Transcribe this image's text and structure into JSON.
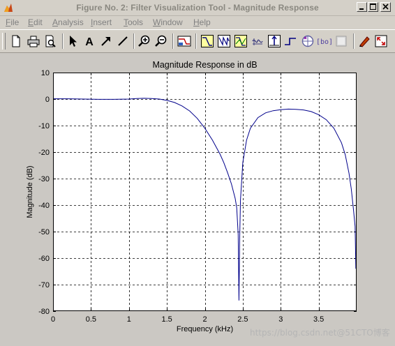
{
  "window": {
    "title": "Figure No. 2: Filter Visualization Tool - Magnitude Response"
  },
  "menu": [
    {
      "label": "File",
      "mnemonic": "F",
      "rest": "ile"
    },
    {
      "label": "Edit",
      "mnemonic": "E",
      "rest": "dit"
    },
    {
      "label": "Analysis",
      "mnemonic": "A",
      "rest": "nalysis"
    },
    {
      "label": "Insert",
      "mnemonic": "I",
      "rest": "nsert"
    },
    {
      "label": "Tools",
      "mnemonic": "T",
      "rest": "ools"
    },
    {
      "label": "Window",
      "mnemonic": "W",
      "rest": "indow"
    },
    {
      "label": "Help",
      "mnemonic": "H",
      "rest": "elp"
    }
  ],
  "toolbar": {
    "buttons": [
      "new-figure-icon",
      "print-icon",
      "print-preview-icon",
      "select-arrow-icon",
      "insert-text-icon",
      "insert-arrow-icon",
      "insert-line-icon",
      "zoom-in-icon",
      "zoom-out-icon",
      "filter-spec-icon",
      "magnitude-response-icon",
      "phase-response-icon",
      "magnitude-phase-icon",
      "group-delay-icon",
      "impulse-response-icon",
      "step-response-icon",
      "pole-zero-icon",
      "filter-coefficients-icon",
      "filter-info-icon",
      "legend-icon",
      "full-view-icon"
    ]
  },
  "colors": {
    "curve": "#00008b",
    "axes_bg": "#ffffff",
    "figure_bg": "#cbc8c3"
  },
  "chart_data": {
    "type": "line",
    "title": "Magnitude Response in dB",
    "xlabel": "Frequency (kHz)",
    "ylabel": "Magnitude (dB)",
    "xlim": [
      0,
      4
    ],
    "ylim": [
      -80,
      10
    ],
    "xticks": [
      0,
      0.5,
      1,
      1.5,
      2,
      2.5,
      3,
      3.5
    ],
    "xtick_labels": [
      "0",
      "0.5",
      "1",
      "1.5",
      "2",
      "2.5",
      "3",
      "3.5"
    ],
    "yticks": [
      10,
      0,
      -10,
      -20,
      -30,
      -40,
      -50,
      -60,
      -70,
      -80
    ],
    "ytick_labels": [
      "10",
      "0",
      "-10",
      "-20",
      "-30",
      "-40",
      "-50",
      "-60",
      "-70",
      "-80"
    ],
    "grid": true,
    "series": [
      {
        "x": [
          0,
          0.2,
          0.4,
          0.6,
          0.8,
          1.0,
          1.1,
          1.2,
          1.3,
          1.4,
          1.5,
          1.6,
          1.7,
          1.8,
          1.9,
          2.0,
          2.1,
          2.2,
          2.25,
          2.3,
          2.35,
          2.4,
          2.42,
          2.44,
          2.45,
          2.46,
          2.47,
          2.5,
          2.55,
          2.6,
          2.7,
          2.8,
          2.9,
          3.0,
          3.1,
          3.2,
          3.3,
          3.4,
          3.5,
          3.6,
          3.7,
          3.8,
          3.85,
          3.9,
          3.93,
          3.96,
          3.98,
          3.99
        ],
        "values": [
          0.1,
          0.1,
          0.0,
          -0.1,
          -0.1,
          0.0,
          0.2,
          0.3,
          0.2,
          0.0,
          -0.5,
          -1.3,
          -2.6,
          -4.5,
          -7.3,
          -11.0,
          -15.5,
          -20.8,
          -24.0,
          -27.8,
          -32.0,
          -37.5,
          -41.0,
          -51.0,
          -76.0,
          -52.0,
          -38.0,
          -24.0,
          -15.5,
          -11.0,
          -7.0,
          -5.2,
          -4.4,
          -4.0,
          -3.8,
          -3.9,
          -4.1,
          -4.7,
          -5.9,
          -7.8,
          -11.0,
          -16.5,
          -21.0,
          -28.0,
          -34.0,
          -42.0,
          -48.0,
          -64.0
        ]
      }
    ]
  },
  "watermark": "https://blog.csdn.net@51CTO博客"
}
